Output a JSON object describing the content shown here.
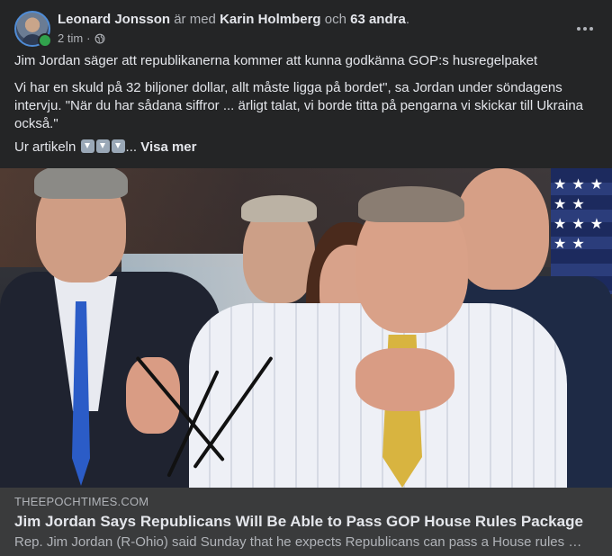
{
  "post": {
    "author": "Leonard Jonsson",
    "with_text": "är med",
    "tagged_person": "Karin Holmberg",
    "and_text": "och",
    "others": "63 andra",
    "period": ".",
    "time": "2 tim",
    "time_separator": "·",
    "audience_icon": "globe-icon",
    "more_icon": "more-options-icon",
    "headline_text": "Jim Jordan säger att republikanerna kommer att kunna godkänna GOP:s husregelpaket",
    "quote_text": "Vi har en skuld på 32 biljoner dollar, allt måste ligga på bordet\", sa Jordan under söndagens intervju. \"När du har sådana siffror ... ärligt talat, vi borde titta på pengarna vi skickar till Ukraina också.\"",
    "article_prefix": "Ur artikeln",
    "emoji_icons": [
      "down-arrow-emoji",
      "down-arrow-emoji",
      "down-arrow-emoji"
    ],
    "ellipsis": "...",
    "see_more": "Visa mer"
  },
  "link_preview": {
    "domain": "THEEPOCHTIMES.COM",
    "title": "Jim Jordan Says Republicans Will Be Able to Pass GOP House Rules Package",
    "description": "Rep. Jim Jordan (R-Ohio) said Sunday that he expects Republicans can pass a House rules …"
  },
  "colors": {
    "card_bg": "#242526",
    "text_primary": "#e4e6eb",
    "text_secondary": "#b0b3b8",
    "link_bg": "#3a3b3c",
    "online": "#31a24c"
  }
}
